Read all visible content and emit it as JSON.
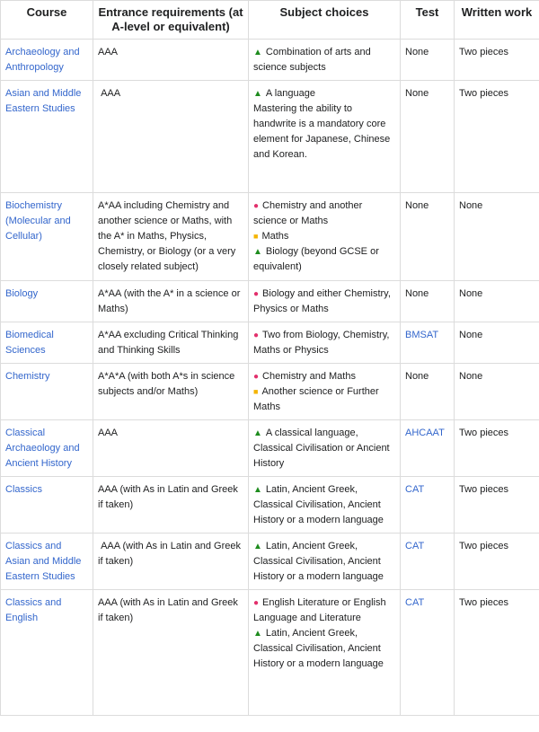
{
  "headers": [
    "Course",
    "Entrance requirements (at A-level or equivalent)",
    "Subject choices",
    "Test",
    "Written work"
  ],
  "colors": {
    "link": "#3366cc",
    "required": "#e2306c",
    "recommended": "#f4b400",
    "helpful": "#1e8c1e"
  },
  "marker_icons": {
    "dot": "pink-dot-icon",
    "square": "yellow-square-icon",
    "triangle": "green-triangle-icon"
  },
  "rows": [
    {
      "course": "Archaeology and Anthropology",
      "entrance": "AAA",
      "subjects": [
        {
          "marker": "triangle",
          "text": "Combination of arts and science subjects"
        }
      ],
      "test": "None",
      "test_link": false,
      "written": "Two pieces"
    },
    {
      "course": "Asian and Middle Eastern Studies",
      "entrance": " AAA",
      "subjects": [
        {
          "marker": "triangle",
          "text": "A language"
        },
        {
          "marker": "",
          "text": "Mastering the ability to handwrite is a mandatory core element for Japanese, Chinese and Korean."
        }
      ],
      "test": "None",
      "test_link": false,
      "written": "Two pieces"
    },
    {
      "course": "Biochemistry (Molecular and Cellular)",
      "entrance": "A*AA including Chemistry and another science or Maths, with the A* in Maths, Physics, Chemistry, or Biology (or a very closely related subject)",
      "subjects": [
        {
          "marker": "dot",
          "text": "Chemistry and another science or Maths"
        },
        {
          "marker": "square",
          "text": "Maths"
        },
        {
          "marker": "triangle",
          "text": "Biology (beyond GCSE or equivalent)"
        }
      ],
      "test": "None",
      "test_link": false,
      "written": "None"
    },
    {
      "course": "Biology",
      "entrance": "A*AA (with the A* in a science or Maths)",
      "subjects": [
        {
          "marker": "dot",
          "text": "Biology and either Chemistry, Physics or Maths"
        }
      ],
      "test": "None",
      "test_link": false,
      "written": "None"
    },
    {
      "course": "Biomedical Sciences",
      "entrance": "A*AA excluding Critical Thinking and Thinking Skills",
      "subjects": [
        {
          "marker": "dot",
          "text": "Two from Biology, Chemistry, Maths or Physics"
        }
      ],
      "test": "BMSAT",
      "test_link": true,
      "written": "None"
    },
    {
      "course": "Chemistry",
      "entrance": "A*A*A (with both A*s in science subjects and/or Maths)",
      "subjects": [
        {
          "marker": "dot",
          "text": "Chemistry and Maths"
        },
        {
          "marker": "square",
          "text": "Another science or Further Maths"
        }
      ],
      "test": "None",
      "test_link": false,
      "written": "None"
    },
    {
      "course": "Classical Archaeology and Ancient History",
      "entrance": "AAA",
      "subjects": [
        {
          "marker": "triangle",
          "text": "A classical language, Classical Civilisation or Ancient History"
        }
      ],
      "test": "AHCAAT",
      "test_link": true,
      "written": "Two pieces"
    },
    {
      "course": "Classics",
      "entrance": "AAA (with As in Latin and Greek if taken)",
      "subjects": [
        {
          "marker": "triangle",
          "text": "Latin, Ancient Greek, Classical Civilisation, Ancient History or a modern language"
        }
      ],
      "test": "CAT",
      "test_link": true,
      "written": "Two pieces"
    },
    {
      "course": "Classics and Asian and Middle Eastern Studies",
      "entrance": " AAA (with As in Latin and Greek if taken)",
      "subjects": [
        {
          "marker": "triangle",
          "text": "Latin, Ancient Greek, Classical Civilisation, Ancient History or a modern language"
        }
      ],
      "test": "CAT",
      "test_link": true,
      "written": "Two pieces"
    },
    {
      "course": "Classics and English",
      "entrance": "AAA (with As in Latin and Greek if taken)",
      "subjects": [
        {
          "marker": "dot",
          "text": "English Literature or English Language and Literature"
        },
        {
          "marker": "triangle",
          "text": "Latin, Ancient Greek, Classical Civilisation, Ancient History or a modern language"
        }
      ],
      "test": "CAT",
      "test_link": true,
      "written": "Two pieces"
    }
  ]
}
